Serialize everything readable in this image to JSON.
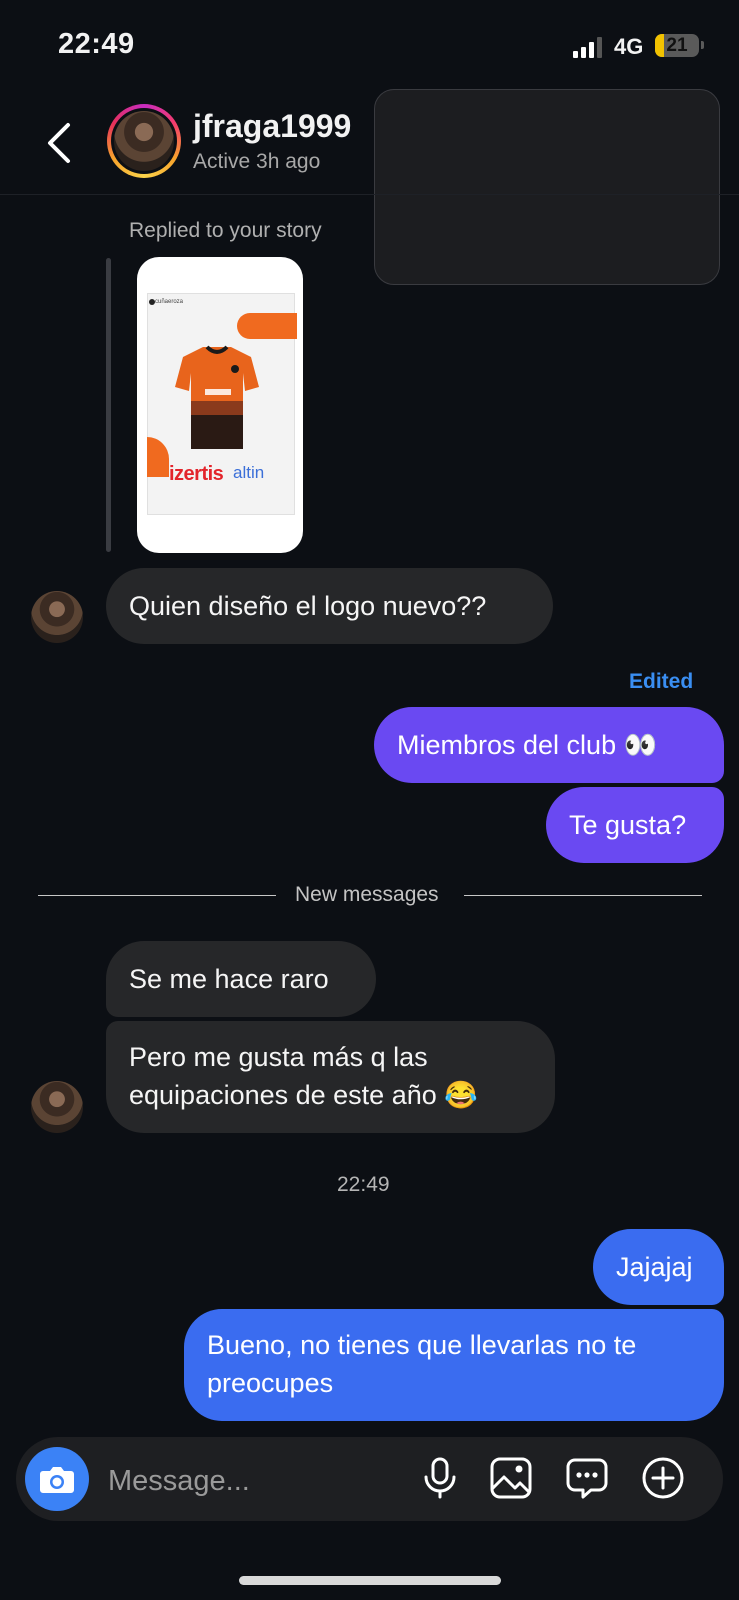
{
  "status_bar": {
    "time": "22:49",
    "network": "4G",
    "battery": "21",
    "battery_fraction": 0.21
  },
  "header": {
    "username": "jfraga1999",
    "active_status": "Active 3h ago"
  },
  "story_reply": {
    "label": "Replied to your story",
    "story_account": "cuñaeroza",
    "brand_left": "izertis",
    "brand_right": "altin"
  },
  "messages": {
    "incoming_1": "Quien diseño el logo nuevo??",
    "edited_label": "Edited",
    "outgoing_1": "Miembros del club 👀",
    "outgoing_2": "Te gusta?",
    "new_messages_label": "New messages",
    "incoming_2": "Se me hace raro",
    "incoming_3": "Pero me gusta más q las equipaciones de este año 😂",
    "timestamp": "22:49",
    "outgoing_3": "Jajajaj",
    "outgoing_4": "Bueno, no tienes que llevarlas no te preocupes"
  },
  "composer": {
    "placeholder": "Message..."
  },
  "colors": {
    "outgoing_purple": "#6a49f2",
    "outgoing_blue": "#3a6cf0",
    "incoming": "#262729",
    "edited": "#3a8ef2",
    "camera": "#3b82f6"
  },
  "icons": [
    "back-icon",
    "camera-icon",
    "microphone-icon",
    "gallery-icon",
    "sticker-icon",
    "plus-icon"
  ]
}
